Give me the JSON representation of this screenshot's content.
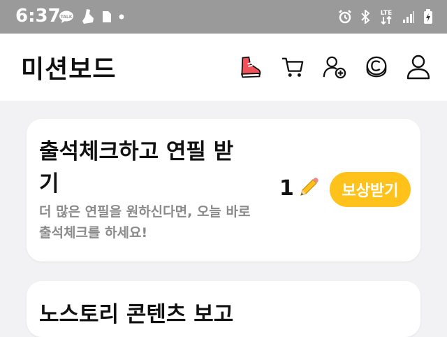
{
  "status_bar": {
    "time": "6:37",
    "left_icons": [
      "talk-icon",
      "sneaker-icon",
      "sim-icon",
      "dot-icon"
    ],
    "right_icons": [
      "alarm-icon",
      "bluetooth-icon",
      "lte-icon",
      "signal-icon",
      "battery-icon"
    ],
    "lte_label": "LTE"
  },
  "header": {
    "title": "미션보드",
    "icons": [
      "sneaker-icon",
      "cart-icon",
      "add-user-icon",
      "coin-icon",
      "profile-icon"
    ]
  },
  "mission_card": {
    "title": "출석체크하고 연필 받기",
    "description": "더 많은 연필을 원하신다면, 오늘 바로 출석체크를 하세요!",
    "reward_count": "1",
    "reward_icon": "pencil-icon",
    "button_label": "보상받기",
    "accent_color": "#ffc21a"
  },
  "next_card": {
    "title": "노스토리 콘텐츠 보고"
  }
}
